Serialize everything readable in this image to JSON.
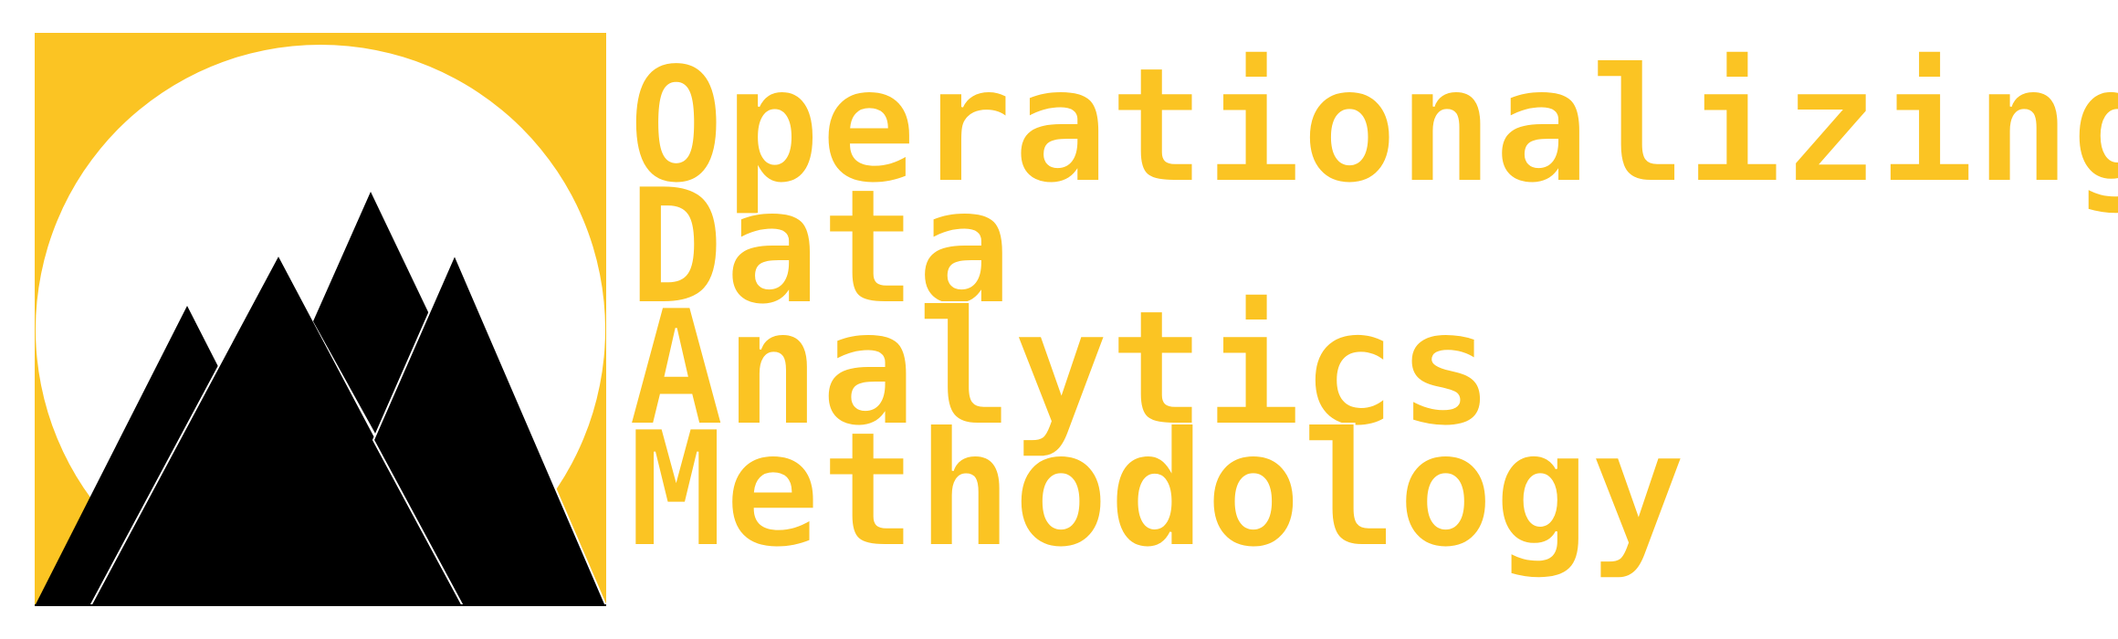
{
  "brand": {
    "name_lines": [
      "Operationalizing",
      "Data",
      "Analytics",
      "Methodology"
    ],
    "colors": {
      "accent": "#FBC423",
      "mountain": "#000000",
      "sun": "#FFFFFF",
      "background": "#FFFFFF"
    },
    "logo_icon": "sun-over-mountains-logo"
  }
}
